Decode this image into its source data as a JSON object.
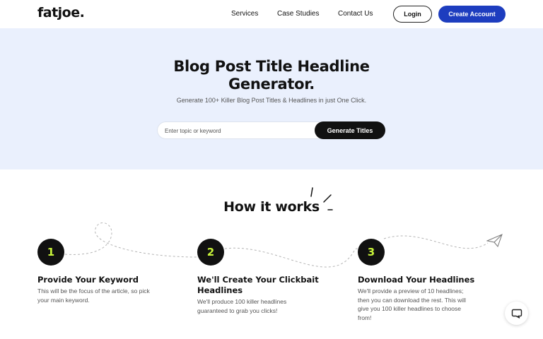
{
  "header": {
    "logo": "fatjoe.",
    "nav": [
      "Services",
      "Case Studies",
      "Contact Us"
    ],
    "login_label": "Login",
    "create_account_label": "Create Account"
  },
  "hero": {
    "title_line1": "Blog Post Title Headline",
    "title_line2": "Generator.",
    "subtitle": "Generate 100+ Killer Blog Post Titles & Headlines in just One Click.",
    "search_placeholder": "Enter topic or keyword",
    "search_value": "",
    "generate_label": "Generate Titles"
  },
  "how": {
    "title": "How it works",
    "steps": [
      {
        "number": "1",
        "title_line1": "Provide Your Keyword",
        "title_line2": "",
        "desc_lines": [
          "This will be the focus of the article, so pick",
          "your main keyword."
        ]
      },
      {
        "number": "2",
        "title_line1": "We'll Create Your Clickbait",
        "title_line2": "Headlines",
        "desc_lines": [
          "We'll produce 100 killer headlines",
          "guaranteed to grab you clicks!"
        ]
      },
      {
        "number": "3",
        "title_line1": "Download Your Headlines",
        "title_line2": "",
        "desc_lines": [
          "We'll provide a preview of 10 headlines;",
          "then you can download the rest. This will",
          "give you 100 killer headlines to choose",
          "from!"
        ]
      }
    ]
  },
  "colors": {
    "brand_blue": "#1d3dbf",
    "hero_bg": "#eaf0fd",
    "step_number": "#c7f23a",
    "dark": "#111111"
  },
  "icons": {
    "sparkle": "sparkle-icon",
    "paper_plane": "paper-plane-icon",
    "chat": "chat-icon"
  }
}
